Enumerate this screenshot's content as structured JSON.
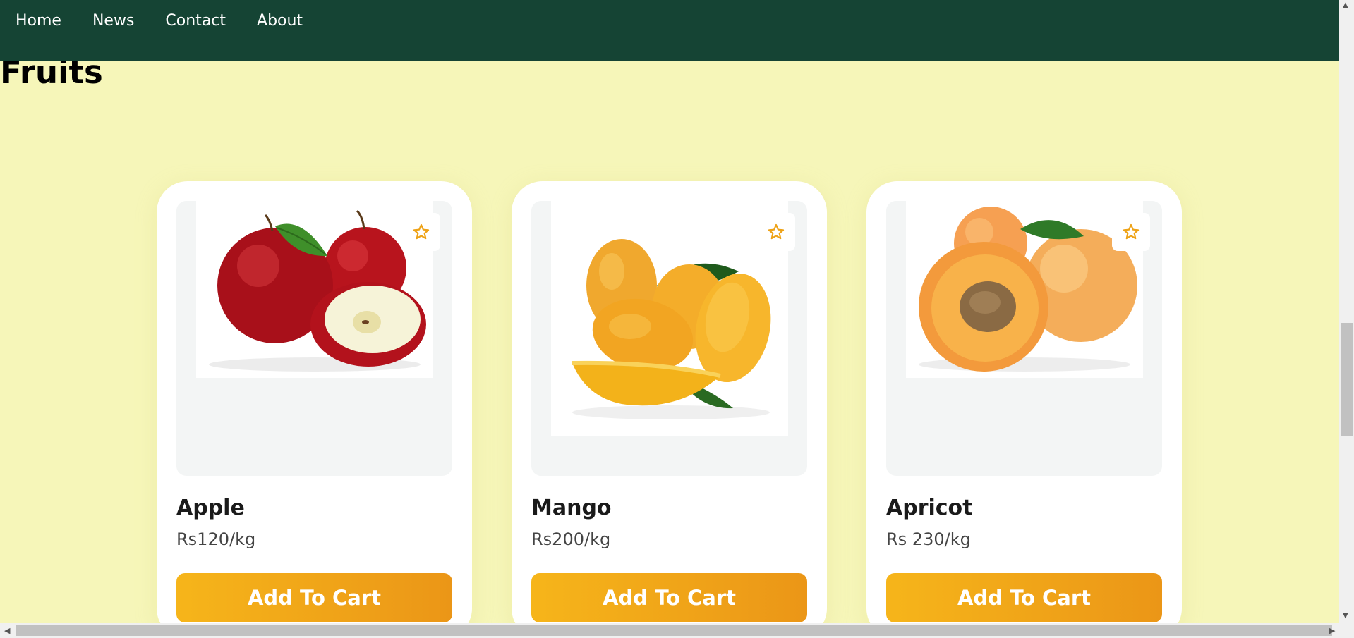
{
  "nav": {
    "items": [
      {
        "label": "Home"
      },
      {
        "label": "News"
      },
      {
        "label": "Contact"
      },
      {
        "label": "About"
      }
    ]
  },
  "page": {
    "title": "Fruits"
  },
  "products": [
    {
      "name": "Apple",
      "price": "Rs120/kg",
      "button_label": "Add To Cart",
      "favorite_icon": "star-outline-icon"
    },
    {
      "name": "Mango",
      "price": "Rs200/kg",
      "button_label": "Add To Cart",
      "favorite_icon": "star-outline-icon"
    },
    {
      "name": "Apricot",
      "price": "Rs 230/kg",
      "button_label": "Add To Cart",
      "favorite_icon": "star-outline-icon"
    }
  ],
  "colors": {
    "navbar": "#154434",
    "page_background": "#f6f6b9",
    "button_gradient_start": "#f6b51a",
    "button_gradient_end": "#eb9617",
    "star": "#eea216"
  }
}
